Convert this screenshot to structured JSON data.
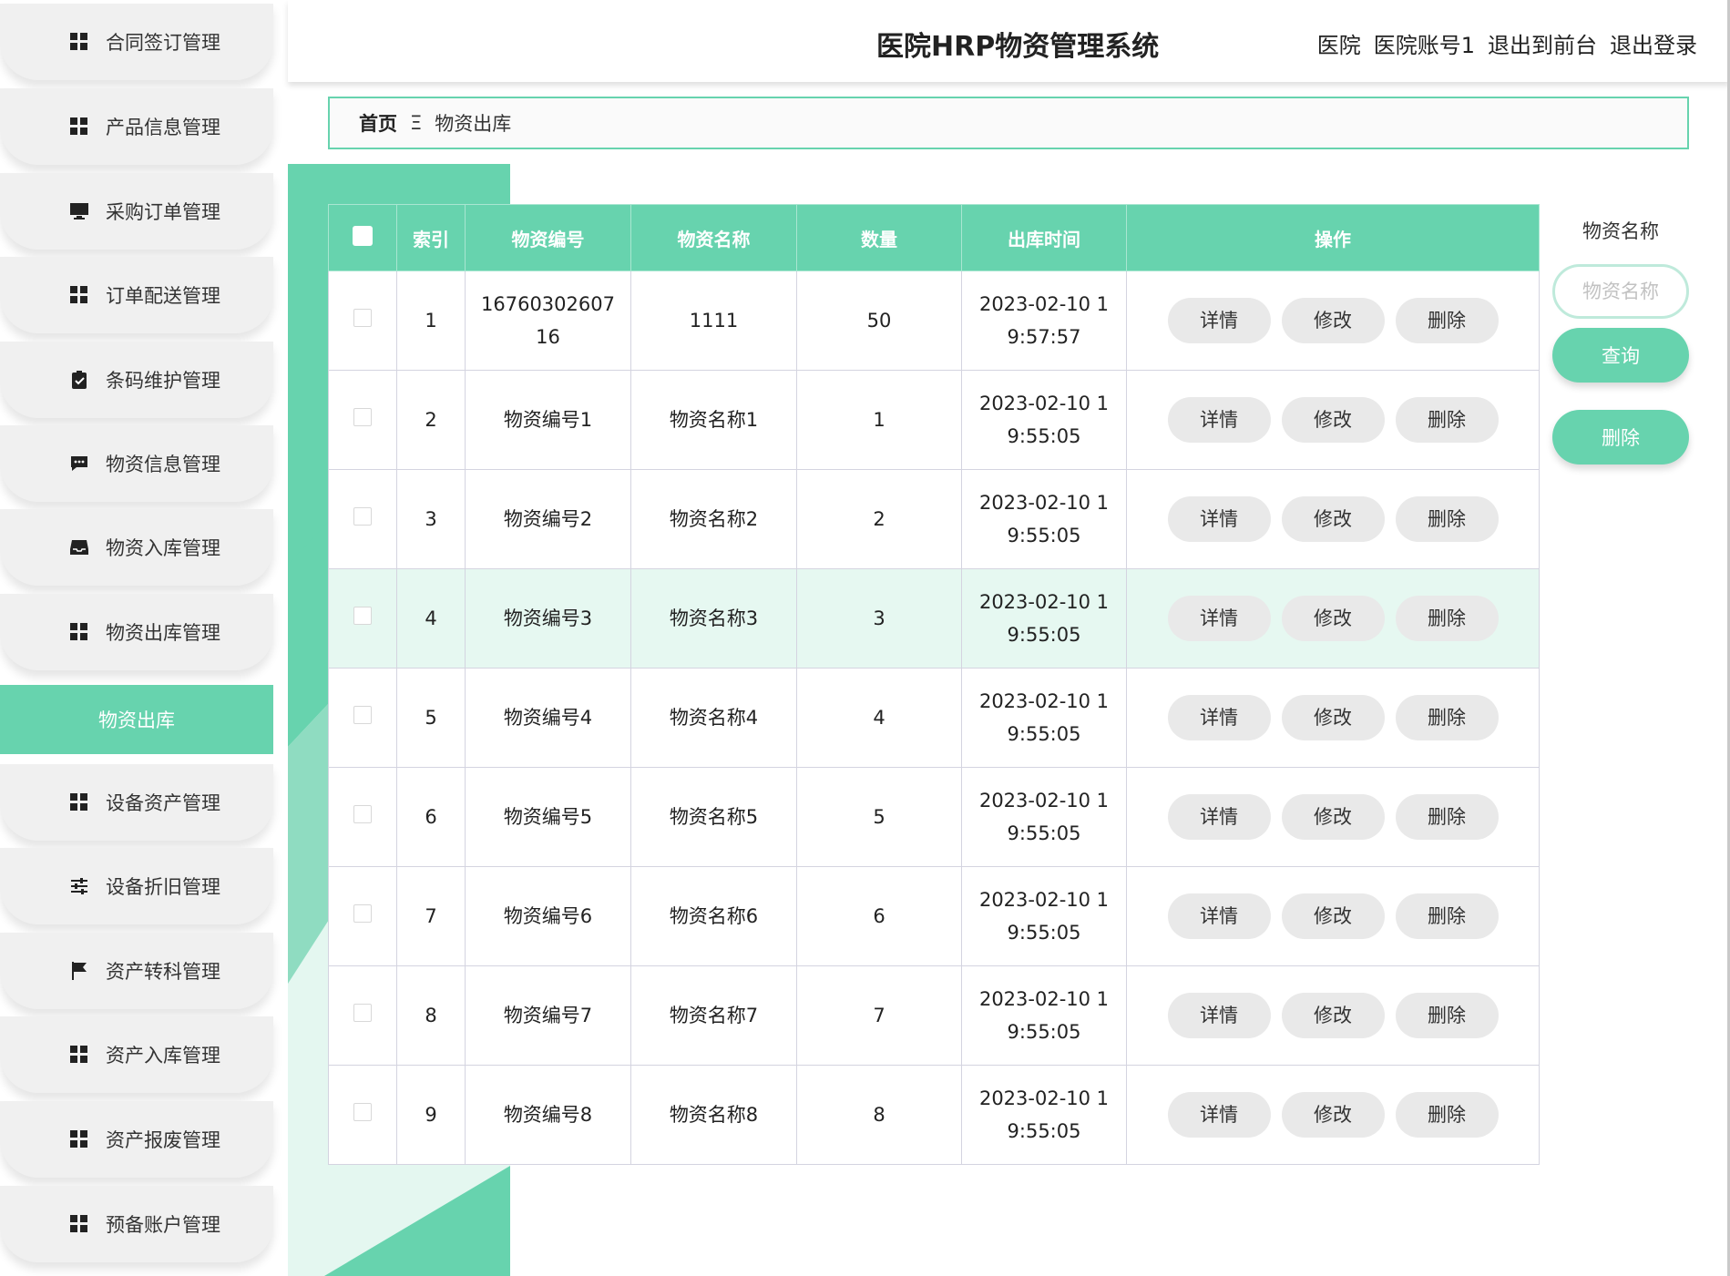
{
  "header": {
    "title": "医院HRP物资管理系统",
    "role": "医院",
    "account": "医院账号1",
    "to_front": "退出到前台",
    "logout": "退出登录"
  },
  "sidebar": {
    "items": [
      {
        "label": "合同签订管理",
        "icon": "grid-icon"
      },
      {
        "label": "产品信息管理",
        "icon": "grid-icon"
      },
      {
        "label": "采购订单管理",
        "icon": "monitor-icon"
      },
      {
        "label": "订单配送管理",
        "icon": "grid-icon"
      },
      {
        "label": "条码维护管理",
        "icon": "clipboard-check-icon"
      },
      {
        "label": "物资信息管理",
        "icon": "chat-icon"
      },
      {
        "label": "物资入库管理",
        "icon": "inbox-icon"
      },
      {
        "label": "物资出库管理",
        "icon": "grid-icon"
      },
      {
        "label": "设备资产管理",
        "icon": "grid-icon"
      },
      {
        "label": "设备折旧管理",
        "icon": "sliders-icon"
      },
      {
        "label": "资产转科管理",
        "icon": "flag-icon"
      },
      {
        "label": "资产入库管理",
        "icon": "grid-icon"
      },
      {
        "label": "资产报废管理",
        "icon": "grid-icon"
      },
      {
        "label": "预备账户管理",
        "icon": "grid-icon"
      }
    ],
    "active_sub": "物资出库"
  },
  "breadcrumb": {
    "home": "首页",
    "separator": "Ξ",
    "current": "物资出库"
  },
  "table": {
    "columns": [
      "索引",
      "物资编号",
      "物资名称",
      "数量",
      "出库时间",
      "操作"
    ],
    "rows": [
      {
        "index": "1",
        "code": "1676030260716",
        "name": "1111",
        "qty": "50",
        "time": "2023-02-10 19:57:57"
      },
      {
        "index": "2",
        "code": "物资编号1",
        "name": "物资名称1",
        "qty": "1",
        "time": "2023-02-10 19:55:05"
      },
      {
        "index": "3",
        "code": "物资编号2",
        "name": "物资名称2",
        "qty": "2",
        "time": "2023-02-10 19:55:05"
      },
      {
        "index": "4",
        "code": "物资编号3",
        "name": "物资名称3",
        "qty": "3",
        "time": "2023-02-10 19:55:05"
      },
      {
        "index": "5",
        "code": "物资编号4",
        "name": "物资名称4",
        "qty": "4",
        "time": "2023-02-10 19:55:05"
      },
      {
        "index": "6",
        "code": "物资编号5",
        "name": "物资名称5",
        "qty": "5",
        "time": "2023-02-10 19:55:05"
      },
      {
        "index": "7",
        "code": "物资编号6",
        "name": "物资名称6",
        "qty": "6",
        "time": "2023-02-10 19:55:05"
      },
      {
        "index": "8",
        "code": "物资编号7",
        "name": "物资名称7",
        "qty": "7",
        "time": "2023-02-10 19:55:05"
      },
      {
        "index": "9",
        "code": "物资编号8",
        "name": "物资名称8",
        "qty": "8",
        "time": "2023-02-10 19:55:05"
      }
    ],
    "actions": {
      "detail": "详情",
      "edit": "修改",
      "delete": "删除"
    },
    "highlighted_row_index": 3
  },
  "search": {
    "label": "物资名称",
    "placeholder": "物资名称",
    "query_button": "查询",
    "delete_button": "删除"
  },
  "colors": {
    "accent": "#67d3ae",
    "row_highlight": "#e6f8f1",
    "button_gray": "#e9e9e9"
  }
}
